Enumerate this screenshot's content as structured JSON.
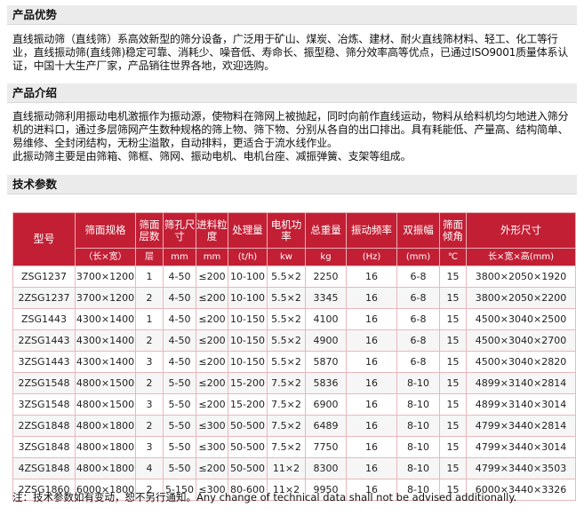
{
  "sections": {
    "advantages": {
      "title": "产品优势",
      "text": "直线振动筛（直线筛）系高效新型的筛分设备，广泛用于矿山、煤炭、冶炼、建材、耐火直线筛材料、轻工、化工等行业，直线振动筛(直线筛)稳定可靠、消耗少、噪音低、寿命长、振型稳、筛分效率高等优点，已通过ISO9001质量体系认证，中国十大生产厂家，产品销往世界各地，欢迎选购。"
    },
    "intro": {
      "title": "产品介绍",
      "para1": "直线振动筛利用振动电机激振作为振动源，使物料在筛网上被抛起，同时向前作直线运动，物料从给料机均匀地进入筛分机的进料口，通过多层筛网产生数种规格的筛上物、筛下物、分别从各自的出口排出。具有耗能低、产量高、结构简单、易维修、全封闭结构，无粉尘溢散，自动排料，更适合于流水线作业。",
      "para2": "此振动筛主要是由筛箱、筛框、筛网、振动电机、电机台座、减振弹簧、支架等组成。"
    },
    "specs": {
      "title": "技术参数"
    }
  },
  "table": {
    "headers": [
      "型号",
      "筛面规格",
      "筛面层数",
      "筛孔尺寸",
      "进料粒度",
      "处理量",
      "电机功率",
      "总重量",
      "振动频率",
      "双振幅",
      "筛面倾角",
      "外形尺寸"
    ],
    "units": [
      "（长×宽）",
      "层",
      "mm",
      "mm",
      "(t/h)",
      "kw",
      "kg",
      "(Hz)",
      "(mm)",
      "℃",
      "长×宽×高(mm)"
    ],
    "rows": [
      [
        "ZSG1237",
        "3700×1200",
        "1",
        "4-50",
        "≤200",
        "10-100",
        "5.5×2",
        "2250",
        "16",
        "6-8",
        "15",
        "3800×2050×1920"
      ],
      [
        "2ZSG1237",
        "3700×1200",
        "2",
        "4-50",
        "≤200",
        "10-100",
        "5.5×2",
        "3345",
        "16",
        "6-8",
        "15",
        "3800×2050×2200"
      ],
      [
        "ZSG1443",
        "4300×1400",
        "1",
        "4-50",
        "≤200",
        "10-150",
        "5.5×2",
        "4100",
        "16",
        "6-8",
        "15",
        "4500×3040×2500"
      ],
      [
        "2ZSG1443",
        "4300×1400",
        "2",
        "4-50",
        "≤200",
        "10-150",
        "5.5×2",
        "4900",
        "16",
        "6-8",
        "15",
        "4500×3040×2700"
      ],
      [
        "3ZSG1443",
        "4300×1400",
        "3",
        "4-50",
        "≤200",
        "10-150",
        "5.5×2",
        "5870",
        "16",
        "6-8",
        "15",
        "4500×3040×2820"
      ],
      [
        "2ZSG1548",
        "4800×1500",
        "2",
        "5-50",
        "≤200",
        "15-200",
        "7.5×2",
        "5836",
        "16",
        "8-10",
        "15",
        "4899×3140×2814"
      ],
      [
        "3ZSG1548",
        "4800×1500",
        "3",
        "5-50",
        "≤200",
        "15-200",
        "7.5×2",
        "6900",
        "16",
        "8-10",
        "15",
        "4899×3140×3014"
      ],
      [
        "2ZSG1848",
        "4800×1800",
        "2",
        "5-50",
        "≤300",
        "50-500",
        "7.5×2",
        "6489",
        "16",
        "8-10",
        "15",
        "4799×3440×2814"
      ],
      [
        "3ZSG1848",
        "4800×1800",
        "3",
        "5-50",
        "≤300",
        "50-500",
        "7.5×2",
        "7750",
        "16",
        "8-10",
        "15",
        "4799×3440×3014"
      ],
      [
        "4ZSG1848",
        "4800×1800",
        "4",
        "5-50",
        "≤200",
        "50-500",
        "11×2",
        "8300",
        "16",
        "8-10",
        "15",
        "4799×3440×3503"
      ],
      [
        "2ZSG1860",
        "6000×1800",
        "2",
        "5-150",
        "≤300",
        "80-600",
        "11×2",
        "9950",
        "16",
        "8-10",
        "15",
        "6000×3440×3326"
      ]
    ]
  },
  "note": "注：技术参数如有变动，恕不另行通知。Any change of technical data shall not be advised additionally."
}
